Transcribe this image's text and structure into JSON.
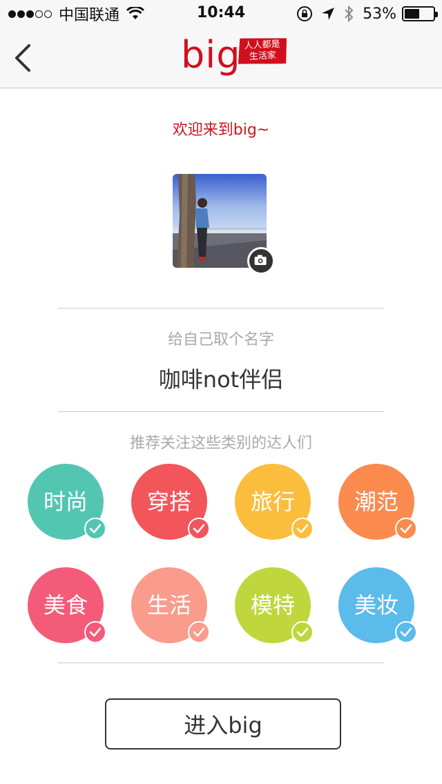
{
  "status_bar": {
    "carrier": "中国联通",
    "time": "10:44",
    "battery_percent": "53%",
    "battery_level": 0.53,
    "signal_bars_filled": 3,
    "signal_bars_total": 5,
    "icons": [
      "wifi-icon",
      "lock-rotation-icon",
      "location-arrow-icon",
      "bluetooth-icon",
      "battery-icon"
    ]
  },
  "nav": {
    "back_icon": "chevron-left-icon",
    "logo_text": "big",
    "logo_tag_line1": "人人都是",
    "logo_tag_line2": "生活家",
    "brand_color": "#d0101e"
  },
  "welcome": "欢迎来到big~",
  "avatar": {
    "camera_icon": "camera-icon"
  },
  "name_section": {
    "label": "给自己取个名字",
    "value": "咖啡not伴侣"
  },
  "recommend_label": "推荐关注这些类别的达人们",
  "categories": [
    {
      "label": "时尚",
      "color": "#53c6b2",
      "checked": true
    },
    {
      "label": "穿搭",
      "color": "#f2555a",
      "checked": true
    },
    {
      "label": "旅行",
      "color": "#fbbd3c",
      "checked": true
    },
    {
      "label": "潮范",
      "color": "#fb8a4f",
      "checked": true
    },
    {
      "label": "美食",
      "color": "#f35b79",
      "checked": true
    },
    {
      "label": "生活",
      "color": "#f99c8c",
      "checked": true
    },
    {
      "label": "模特",
      "color": "#bfd73c",
      "checked": true
    },
    {
      "label": "美妆",
      "color": "#5bbbea",
      "checked": true
    }
  ],
  "enter_button": "进入big"
}
